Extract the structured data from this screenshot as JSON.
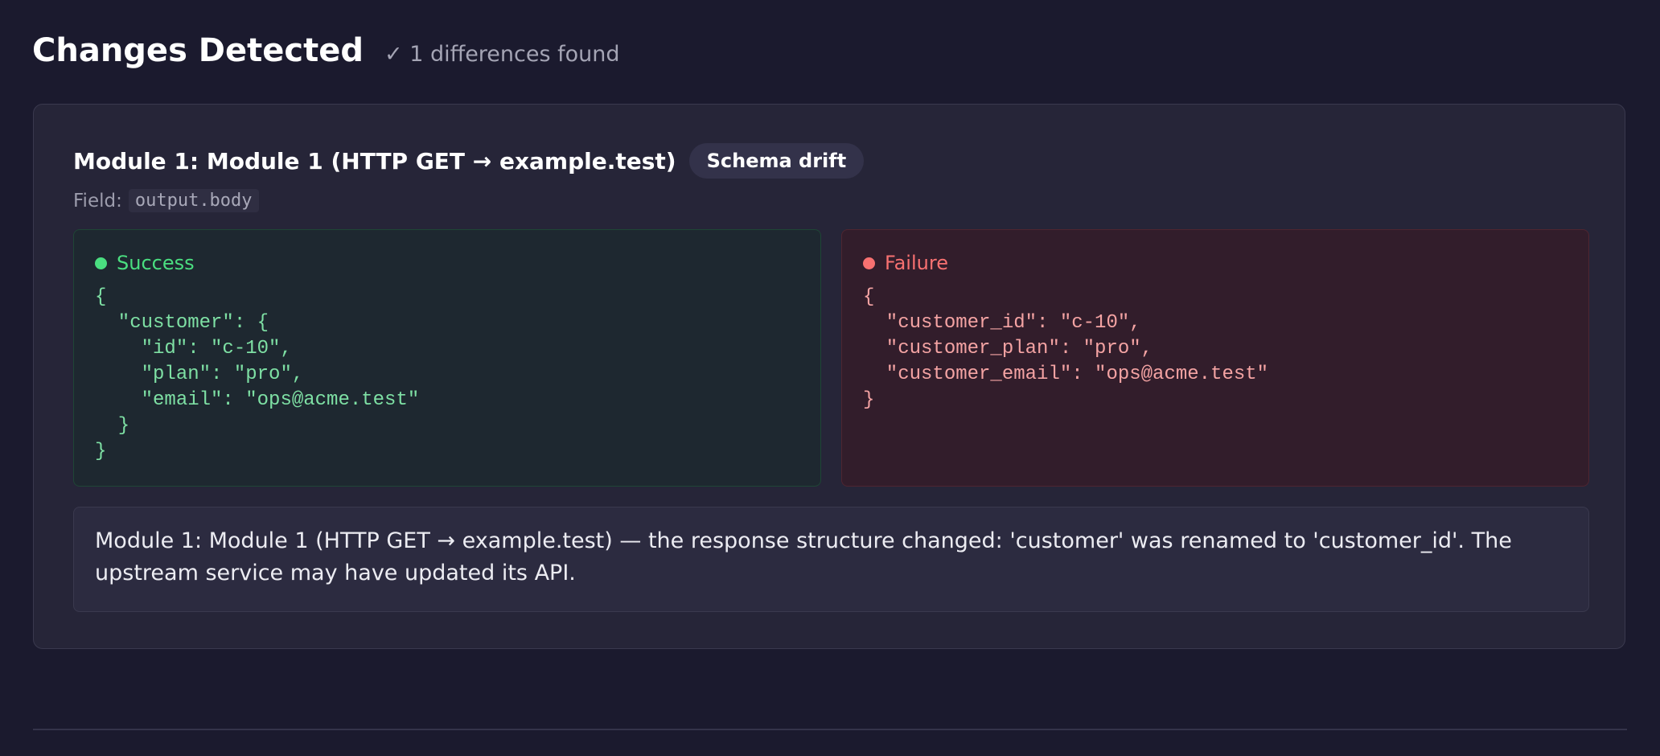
{
  "header": {
    "title": "Changes Detected",
    "diff_count": "✓ 1 differences found"
  },
  "module": {
    "title": "Module 1: Module 1 (HTTP GET → example.test)",
    "badge": "Schema drift",
    "field_label": "Field:",
    "field_value": "output.body"
  },
  "success": {
    "label": "Success",
    "code": "{\n  \"customer\": {\n    \"id\": \"c-10\",\n    \"plan\": \"pro\",\n    \"email\": \"ops@acme.test\"\n  }\n}"
  },
  "failure": {
    "label": "Failure",
    "code": "{\n  \"customer_id\": \"c-10\",\n  \"customer_plan\": \"pro\",\n  \"customer_email\": \"ops@acme.test\"\n}"
  },
  "explanation": "Module 1: Module 1 (HTTP GET → example.test) — the response structure changed: 'customer' was renamed to 'customer_id'. The upstream service may have updated its API.",
  "colors": {
    "background": "#1b1a2e",
    "card": "#262538",
    "success": "#4ade80",
    "failure": "#f87171"
  }
}
